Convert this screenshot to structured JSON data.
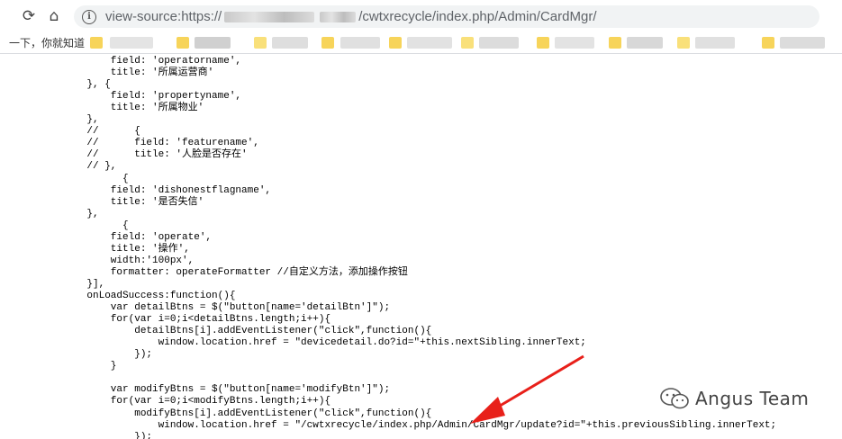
{
  "browser": {
    "url_prefix": "view-source:https://",
    "url_suffix": "/cwtxrecycle/index.php/Admin/CardMgr/",
    "bookmark_first": "一下，你就知道"
  },
  "source_lines": [
    {
      "text": "        field: 'operatorname',"
    },
    {
      "text": "        title: '所属运营商'"
    },
    {
      "text": "    }, {"
    },
    {
      "text": "        field: 'propertyname',"
    },
    {
      "text": "        title: '所属物业'"
    },
    {
      "text": "    },"
    },
    {
      "text": "    //      {"
    },
    {
      "text": "    //      field: 'featurename',"
    },
    {
      "text": "    //      title: '人脸是否存在'"
    },
    {
      "text": "    // },"
    },
    {
      "text": "          {"
    },
    {
      "text": "        field: 'dishonestflagname',"
    },
    {
      "text": "        title: '是否失信'"
    },
    {
      "text": "    },"
    },
    {
      "text": "          {"
    },
    {
      "text": "        field: 'operate',"
    },
    {
      "text": "        title: '操作',"
    },
    {
      "text": "        width:'100px',"
    },
    {
      "text": "        formatter: operateFormatter //自定义方法，添加操作按钮"
    },
    {
      "text": "    }],"
    },
    {
      "text": "    onLoadSuccess:function(){"
    },
    {
      "text": "        var detailBtns = $(\"button[name='detailBtn']\");"
    },
    {
      "text": "        for(var i=0;i<detailBtns.length;i++){"
    },
    {
      "text": "            detailBtns[i].addEventListener(\"click\",function(){"
    },
    {
      "text": "                window.location.href = \"devicedetail.do?id=\"+this.nextSibling.innerText;"
    },
    {
      "text": "            });"
    },
    {
      "text": "        }"
    },
    {
      "text": ""
    },
    {
      "text": "        var modifyBtns = $(\"button[name='modifyBtn']\");"
    },
    {
      "text": "        for(var i=0;i<modifyBtns.length;i++){"
    },
    {
      "text": "            modifyBtns[i].addEventListener(\"click\",function(){"
    },
    {
      "text": "                window.location.href = \"/cwtxrecycle/index.php/Admin/CardMgr/update?id=\"+this.previousSibling.innerText;"
    },
    {
      "text": "            });"
    }
  ],
  "watermark": {
    "text": "Angus Team"
  },
  "colors": {
    "arrow": "#e8201a",
    "string": "#1a1aa6"
  }
}
